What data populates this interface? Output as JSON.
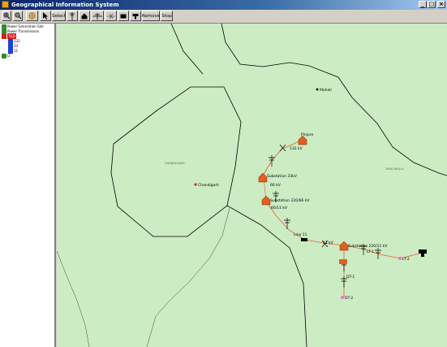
{
  "window": {
    "title": "Geographical Information System",
    "controls": [
      "_",
      "□",
      "×"
    ]
  },
  "toolbar": {
    "select_label": "Select",
    "remove_label": "Remove",
    "stop_label": "Stop"
  },
  "tree": {
    "items": [
      {
        "label": "Power Generation Site",
        "icon": "plant-icon",
        "color": "#2e8b2e"
      },
      {
        "label": "Power Transmission",
        "icon": "tower-icon",
        "color": "#2e8b2e"
      },
      {
        "label": "T&D",
        "icon": "folder-icon",
        "color": "#d81e1e",
        "selected": true
      },
      {
        "label": "132",
        "icon": "folder-icon",
        "color": "#1e3fd8"
      },
      {
        "label": "33",
        "icon": "folder-icon",
        "color": "#1e3fd8"
      },
      {
        "label": "11",
        "icon": "folder-icon",
        "color": "#1e3fd8"
      },
      {
        "label": "LT",
        "icon": "plant-icon",
        "color": "#2e8b2e"
      }
    ]
  },
  "map": {
    "place_labels": {
      "chandigarh": "Chandigarh",
      "mohali": "Mohali",
      "region_mid": "CHANDIGARH",
      "region_right": "PANCHKULA",
      "pinjore": "Pinjore"
    },
    "substations": {
      "s1": "Substation 33kV",
      "s2": "Substation 220/66 kV",
      "s3": "Substation 220/11 kV"
    },
    "line_labels": {
      "l1": "132 kV",
      "l2": "66 kV",
      "l3": "66/11 kV",
      "l4": "11 kV",
      "l5": "Line 11",
      "l6": "LT-1",
      "l7": "LT-2",
      "l8": "DT-1",
      "l9": "DT-2"
    },
    "colors": {
      "background": "#ccecc4",
      "power_line": "#e0622a",
      "substation": "#e0601e",
      "consumer": "#ff66cc",
      "city_marker": "#e02020"
    }
  }
}
